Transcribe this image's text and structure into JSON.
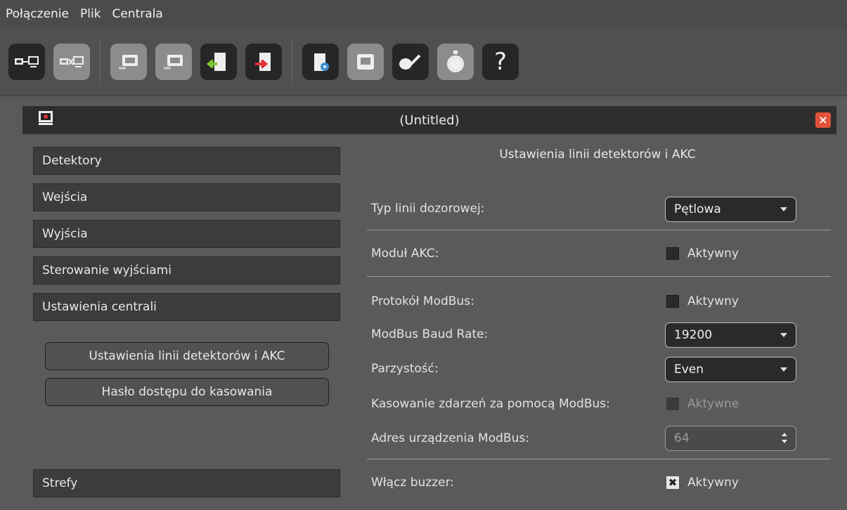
{
  "menu": [
    "Połączenie",
    "Plik",
    "Centrala"
  ],
  "toolbar": {
    "icons": [
      "connect-icon",
      "disconnect-icon",
      "read-config-icon",
      "write-config-icon",
      "import-icon",
      "export-icon",
      "settings-doc-icon",
      "panel-icon",
      "calibrate-icon",
      "timer-icon",
      "help-icon"
    ],
    "help_label": "?"
  },
  "window": {
    "title": "(Untitled)",
    "close_label": "×"
  },
  "sidebar": {
    "items": [
      "Detektory",
      "Wejścia",
      "Wyjścia",
      "Sterowanie wyjściami",
      "Ustawienia centrali"
    ],
    "sub_buttons": [
      "Ustawienia linii detektorów i AKC",
      "Hasło dostępu do kasowania"
    ],
    "bottom_item": "Strefy"
  },
  "settings": {
    "title": "Ustawienia linii detektorów i AKC",
    "line_type": {
      "label": "Typ linii dozorowej:",
      "value": "Pętlowa"
    },
    "akc": {
      "label": "Moduł AKC:",
      "checkbox": "Aktywny",
      "checked": false
    },
    "modbus": {
      "label": "Protokół ModBus:",
      "checkbox": "Aktywny",
      "checked": false
    },
    "baud": {
      "label": "ModBus Baud Rate:",
      "value": "19200"
    },
    "parity": {
      "label": "Parzystość:",
      "value": "Even"
    },
    "reset_events": {
      "label": "Kasowanie zdarzeń za pomocą ModBus:",
      "checkbox": "Aktywne",
      "checked": false,
      "disabled": true
    },
    "address": {
      "label": "Adres urządzenia ModBus:",
      "value": "64"
    },
    "buzzer": {
      "label": "Włącz buzzer:",
      "checkbox": "Aktywny",
      "checked": true
    },
    "check_mark": "✖"
  }
}
